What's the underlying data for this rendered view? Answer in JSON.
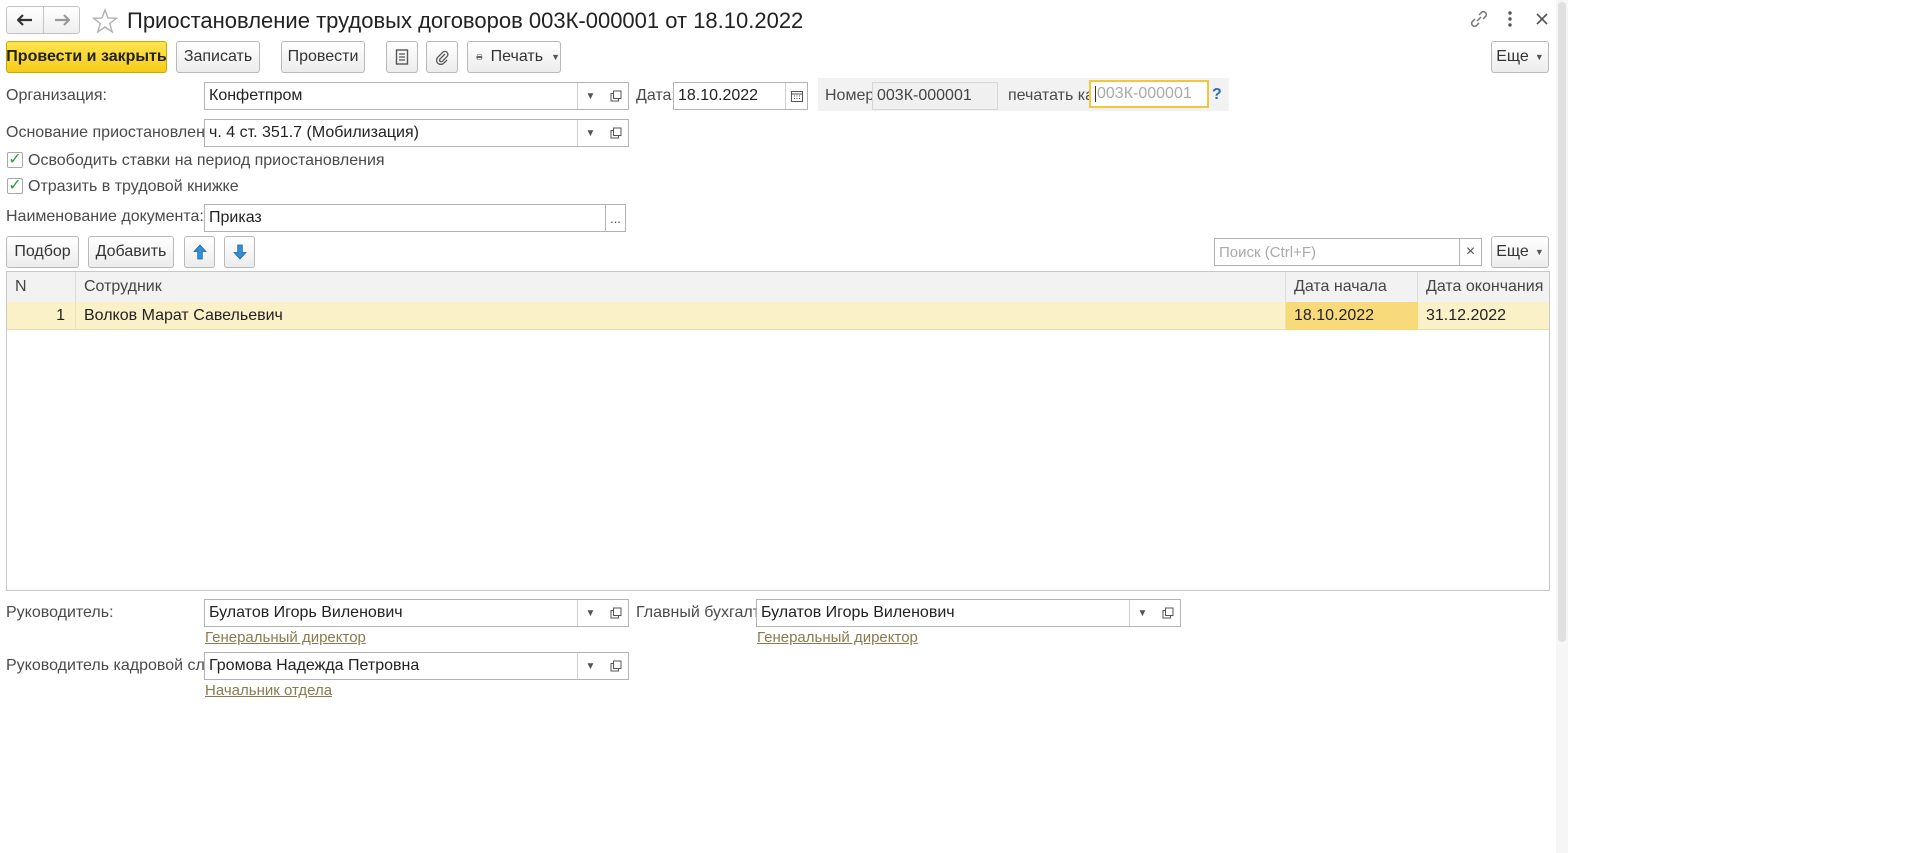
{
  "header": {
    "title": "Приостановление трудовых договоров 003К-000001 от 18.10.2022",
    "back_icon": "arrow-left-icon",
    "forward_icon": "arrow-right-icon",
    "favorite_icon": "star-icon"
  },
  "toolbar": {
    "post_close": "Провести и закрыть",
    "save": "Записать",
    "post": "Провести",
    "print": "Печать",
    "more": "Еще"
  },
  "form": {
    "org_label": "Организация:",
    "org_value": "Конфетпром",
    "date_label": "Дата:",
    "date_value": "18.10.2022",
    "number_label": "Номер:",
    "number_value": "003К-000001",
    "print_as_label": "печатать как:",
    "print_as_placeholder": "003К-000001",
    "help": "?",
    "basis_label": "Основание приостановления:",
    "basis_value": "ч. 4 ст. 351.7 (Мобилизация)",
    "release_rates_label": "Освободить ставки на период приостановления",
    "workbook_label": "Отразить в трудовой книжке",
    "doc_name_label": "Наименование документа:",
    "doc_name_value": "Приказ",
    "ellipsis": "..."
  },
  "table_toolbar": {
    "pick": "Подбор",
    "add": "Добавить",
    "search_placeholder": "Поиск (Ctrl+F)",
    "clear": "×",
    "more": "Еще"
  },
  "table": {
    "columns": [
      "N",
      "Сотрудник",
      "Дата начала",
      "Дата окончания"
    ],
    "rows": [
      {
        "n": "1",
        "employee": "Волков Марат Савельевич",
        "start": "18.10.2022",
        "end": "31.12.2022"
      }
    ]
  },
  "footer": {
    "head_label": "Руководитель:",
    "head_value": "Булатов Игорь Виленович",
    "head_position": "Генеральный директор",
    "chief_acc_label": "Главный бухгалтер:",
    "chief_acc_value": "Булатов Игорь Виленович",
    "chief_acc_position": "Генеральный директор",
    "hr_head_label": "Руководитель кадровой службы:",
    "hr_head_value": "Громова Надежда Петровна",
    "hr_head_position": "Начальник отдела"
  }
}
